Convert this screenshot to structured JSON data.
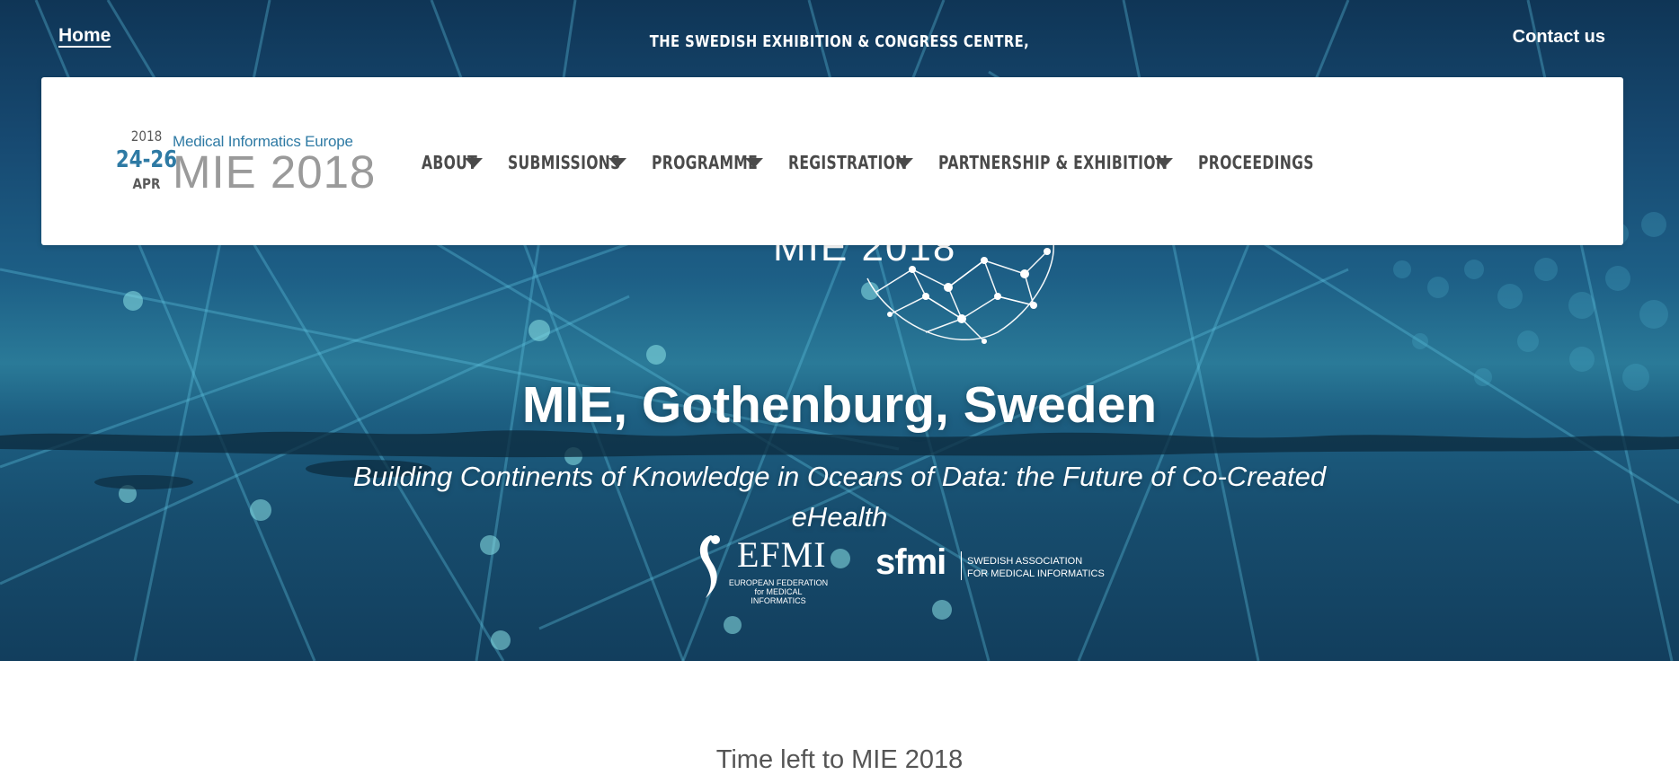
{
  "top_bar": {
    "home_label": "Home",
    "venue_text": "THE SWEDISH EXHIBITION & CONGRESS CENTRE,",
    "contact_label": "Contact us"
  },
  "event_date": {
    "year": "2018",
    "days": "24-26",
    "month": "APR"
  },
  "logo": {
    "subtitle": "Medical Informatics Europe",
    "title": "MIE 2018"
  },
  "nav": {
    "items": [
      {
        "label": "ABOUT",
        "icon": "caret-down-icon"
      },
      {
        "label": "SUBMISSIONS",
        "icon": "caret-down-icon"
      },
      {
        "label": "PROGRAMME",
        "icon": "caret-down-icon"
      },
      {
        "label": "REGISTRATION",
        "icon": "caret-down-icon"
      },
      {
        "label": "PARTNERSHIP & EXHIBITION",
        "icon": "caret-down-icon"
      },
      {
        "label": "PROCEEDINGS"
      }
    ]
  },
  "hero": {
    "logo_text": "MIE 2018",
    "title": "MIE, Gothenburg, Sweden",
    "subtitle": "Building Continents of Knowledge in Oceans of Data: the Future of Co-Created eHealth",
    "partners": {
      "efmi": {
        "name": "EFMI",
        "line1": "EUROPEAN FEDERATION",
        "line2": "for MEDICAL INFORMATICS"
      },
      "sfmi": {
        "name": "sfmi",
        "line1": "SWEDISH ASSOCIATION",
        "line2": "FOR MEDICAL INFORMATICS"
      }
    }
  },
  "countdown": {
    "title": "Time left to MIE 2018"
  },
  "colors": {
    "accent": "#2e7aa4",
    "nav_text": "#4a4a4a",
    "hero_bg": "#1d5f86"
  }
}
